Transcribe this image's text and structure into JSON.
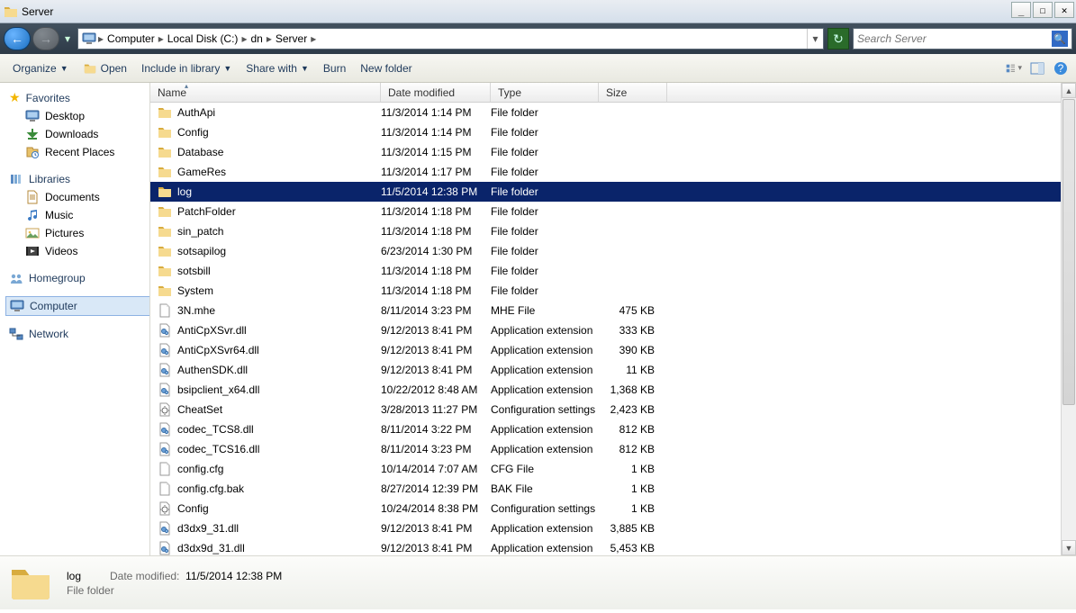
{
  "window": {
    "title": "Server"
  },
  "breadcrumb": {
    "root": "Computer",
    "segments": [
      "Local Disk (C:)",
      "dn",
      "Server"
    ]
  },
  "search": {
    "placeholder": "Search Server"
  },
  "toolbar": {
    "organize": "Organize",
    "open": "Open",
    "include": "Include in library",
    "share": "Share with",
    "burn": "Burn",
    "newfolder": "New folder"
  },
  "sidebar": {
    "favorites": {
      "label": "Favorites",
      "items": [
        "Desktop",
        "Downloads",
        "Recent Places"
      ]
    },
    "libraries": {
      "label": "Libraries",
      "items": [
        "Documents",
        "Music",
        "Pictures",
        "Videos"
      ]
    },
    "homegroup": "Homegroup",
    "computer": "Computer",
    "network": "Network"
  },
  "columns": {
    "name": "Name",
    "date": "Date modified",
    "type": "Type",
    "size": "Size"
  },
  "files": [
    {
      "icon": "folder",
      "name": "AuthApi",
      "date": "11/3/2014 1:14 PM",
      "type": "File folder",
      "size": ""
    },
    {
      "icon": "folder",
      "name": "Config",
      "date": "11/3/2014 1:14 PM",
      "type": "File folder",
      "size": ""
    },
    {
      "icon": "folder",
      "name": "Database",
      "date": "11/3/2014 1:15 PM",
      "type": "File folder",
      "size": ""
    },
    {
      "icon": "folder",
      "name": "GameRes",
      "date": "11/3/2014 1:17 PM",
      "type": "File folder",
      "size": ""
    },
    {
      "icon": "folder",
      "name": "log",
      "date": "11/5/2014 12:38 PM",
      "type": "File folder",
      "size": "",
      "selected": true
    },
    {
      "icon": "folder",
      "name": "PatchFolder",
      "date": "11/3/2014 1:18 PM",
      "type": "File folder",
      "size": ""
    },
    {
      "icon": "folder",
      "name": "sin_patch",
      "date": "11/3/2014 1:18 PM",
      "type": "File folder",
      "size": ""
    },
    {
      "icon": "folder",
      "name": "sotsapilog",
      "date": "6/23/2014 1:30 PM",
      "type": "File folder",
      "size": ""
    },
    {
      "icon": "folder",
      "name": "sotsbill",
      "date": "11/3/2014 1:18 PM",
      "type": "File folder",
      "size": ""
    },
    {
      "icon": "folder",
      "name": "System",
      "date": "11/3/2014 1:18 PM",
      "type": "File folder",
      "size": ""
    },
    {
      "icon": "file",
      "name": "3N.mhe",
      "date": "8/11/2014 3:23 PM",
      "type": "MHE File",
      "size": "475 KB"
    },
    {
      "icon": "dll",
      "name": "AntiCpXSvr.dll",
      "date": "9/12/2013 8:41 PM",
      "type": "Application extension",
      "size": "333 KB"
    },
    {
      "icon": "dll",
      "name": "AntiCpXSvr64.dll",
      "date": "9/12/2013 8:41 PM",
      "type": "Application extension",
      "size": "390 KB"
    },
    {
      "icon": "dll",
      "name": "AuthenSDK.dll",
      "date": "9/12/2013 8:41 PM",
      "type": "Application extension",
      "size": "11 KB"
    },
    {
      "icon": "dll",
      "name": "bsipclient_x64.dll",
      "date": "10/22/2012 8:48 AM",
      "type": "Application extension",
      "size": "1,368 KB"
    },
    {
      "icon": "cfg",
      "name": "CheatSet",
      "date": "3/28/2013 11:27 PM",
      "type": "Configuration settings",
      "size": "2,423 KB"
    },
    {
      "icon": "dll",
      "name": "codec_TCS8.dll",
      "date": "8/11/2014 3:22 PM",
      "type": "Application extension",
      "size": "812 KB"
    },
    {
      "icon": "dll",
      "name": "codec_TCS16.dll",
      "date": "8/11/2014 3:23 PM",
      "type": "Application extension",
      "size": "812 KB"
    },
    {
      "icon": "file",
      "name": "config.cfg",
      "date": "10/14/2014 7:07 AM",
      "type": "CFG File",
      "size": "1 KB"
    },
    {
      "icon": "file",
      "name": "config.cfg.bak",
      "date": "8/27/2014 12:39 PM",
      "type": "BAK File",
      "size": "1 KB"
    },
    {
      "icon": "cfg",
      "name": "Config",
      "date": "10/24/2014 8:38 PM",
      "type": "Configuration settings",
      "size": "1 KB"
    },
    {
      "icon": "dll",
      "name": "d3dx9_31.dll",
      "date": "9/12/2013 8:41 PM",
      "type": "Application extension",
      "size": "3,885 KB"
    },
    {
      "icon": "dll",
      "name": "d3dx9d_31.dll",
      "date": "9/12/2013 8:41 PM",
      "type": "Application extension",
      "size": "5,453 KB"
    }
  ],
  "details": {
    "name": "log",
    "type": "File folder",
    "date_label": "Date modified:",
    "date": "11/5/2014 12:38 PM"
  }
}
